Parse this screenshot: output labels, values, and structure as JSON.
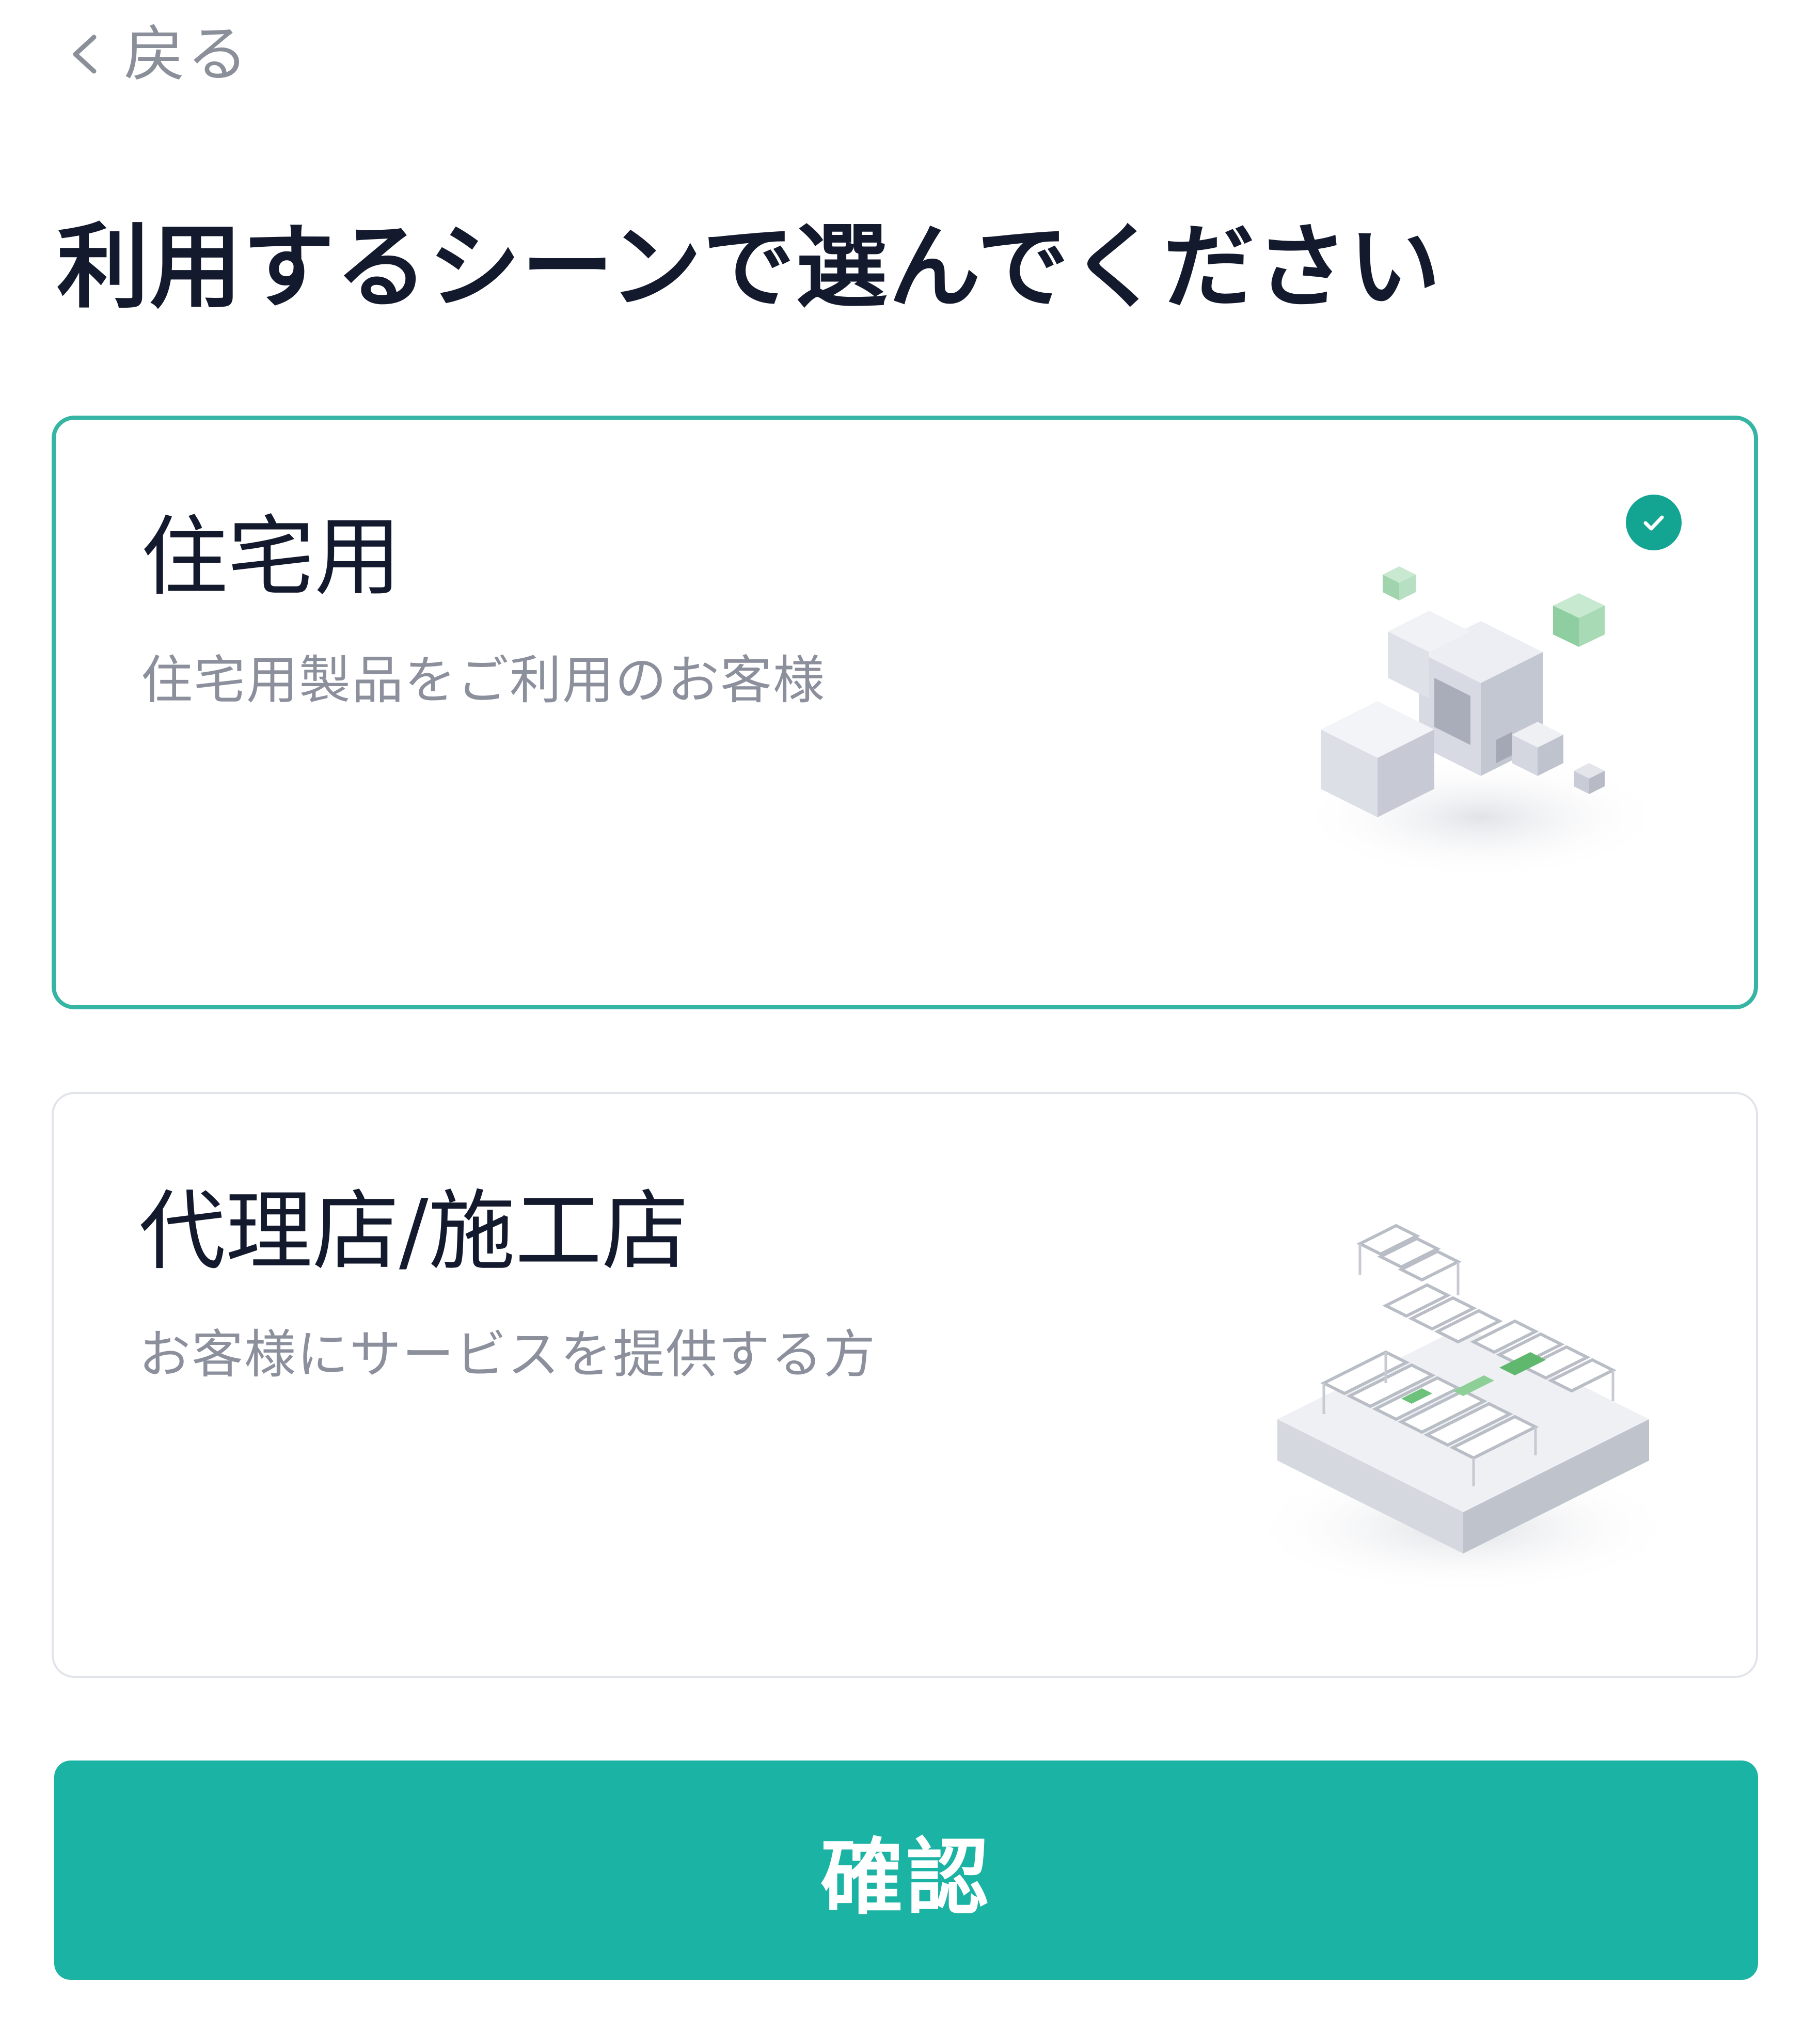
{
  "header": {
    "back_label": "戻る"
  },
  "page": {
    "title": "利用するシーンで選んでください"
  },
  "options": [
    {
      "title": "住宅用",
      "description": "住宅用製品をご利用のお客様",
      "selected": true,
      "illustration": "residential-cubes-illustration"
    },
    {
      "title": "代理店/施工店",
      "description": "お客様にサービスを提供する方",
      "selected": false,
      "illustration": "installer-panels-illustration"
    }
  ],
  "footer": {
    "confirm_label": "確認"
  },
  "colors": {
    "accent": "#1bb3a3",
    "selected_border": "#36b5a5",
    "check_badge": "#13a592",
    "title_text": "#141a2e",
    "muted_text": "#8c909c"
  }
}
